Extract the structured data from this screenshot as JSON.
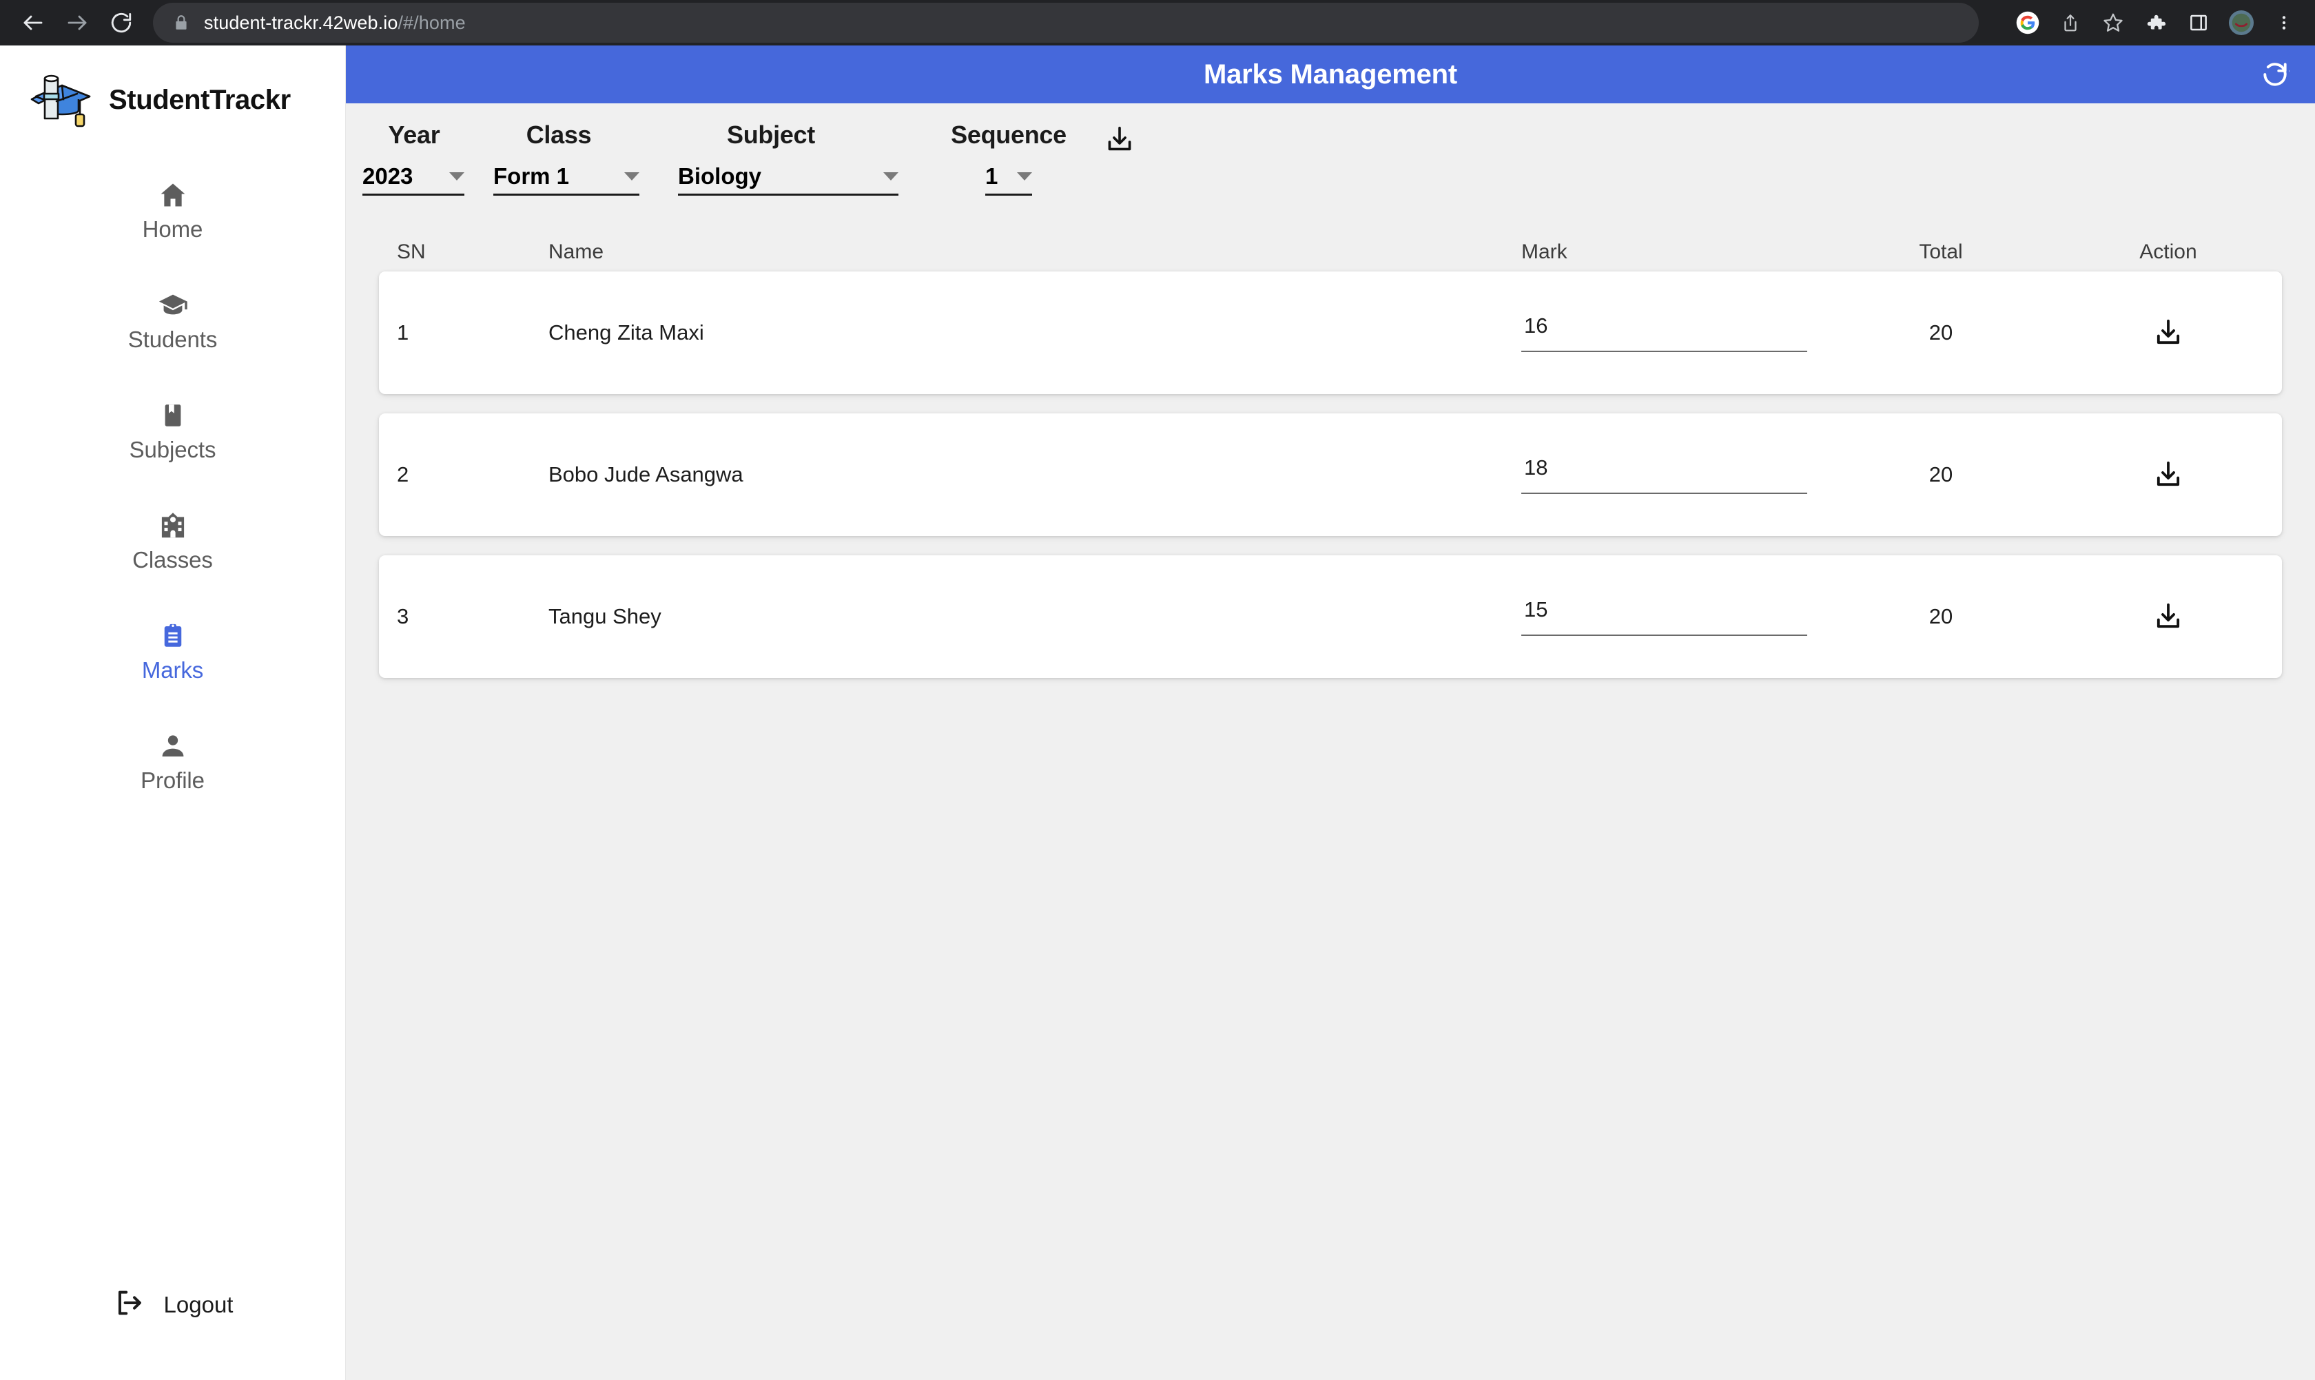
{
  "browser": {
    "url_domain": "student-trackr.42web.io",
    "url_path": "/#/home",
    "back_icon": "back-arrow-icon",
    "forward_icon": "forward-arrow-icon",
    "reload_icon": "reload-icon",
    "lock_icon": "lock-icon",
    "right_icons": [
      "google-icon",
      "share-icon",
      "bookmark-star-icon",
      "extensions-puzzle-icon",
      "side-panel-icon",
      "profile-avatar",
      "chrome-menu-icon"
    ]
  },
  "sidebar": {
    "brand": "StudentTrackr",
    "logo_icon": "graduation-cap-diploma-logo",
    "items": [
      {
        "label": "Home",
        "icon": "home-icon",
        "active": false
      },
      {
        "label": "Students",
        "icon": "graduation-cap-icon",
        "active": false
      },
      {
        "label": "Subjects",
        "icon": "book-bookmark-icon",
        "active": false
      },
      {
        "label": "Classes",
        "icon": "school-building-icon",
        "active": false
      },
      {
        "label": "Marks",
        "icon": "clipboard-icon",
        "active": true
      },
      {
        "label": "Profile",
        "icon": "person-icon",
        "active": false
      }
    ],
    "logout": {
      "label": "Logout",
      "icon": "logout-icon"
    }
  },
  "header": {
    "title": "Marks Management",
    "refresh_icon": "refresh-icon",
    "background_color": "#4668db"
  },
  "filters": {
    "export_icon": "download-icon",
    "fields": [
      {
        "label": "Year",
        "value": "2023"
      },
      {
        "label": "Class",
        "value": "Form 1"
      },
      {
        "label": "Subject",
        "value": "Biology"
      },
      {
        "label": "Sequence",
        "value": "1"
      }
    ]
  },
  "table": {
    "columns": [
      "SN",
      "Name",
      "Mark",
      "Total",
      "Action"
    ],
    "rows": [
      {
        "sn": "1",
        "name": "Cheng Zita Maxi",
        "mark": "16",
        "total": "20",
        "action_icon": "download-icon"
      },
      {
        "sn": "2",
        "name": "Bobo Jude Asangwa",
        "mark": "18",
        "total": "20",
        "action_icon": "download-icon"
      },
      {
        "sn": "3",
        "name": "Tangu Shey",
        "mark": "15",
        "total": "20",
        "action_icon": "download-icon"
      }
    ]
  },
  "colors": {
    "accent": "#4668db",
    "page_bg": "#f0f0f0",
    "sidebar_bg": "#ffffff",
    "chrome_bg": "#212225"
  }
}
